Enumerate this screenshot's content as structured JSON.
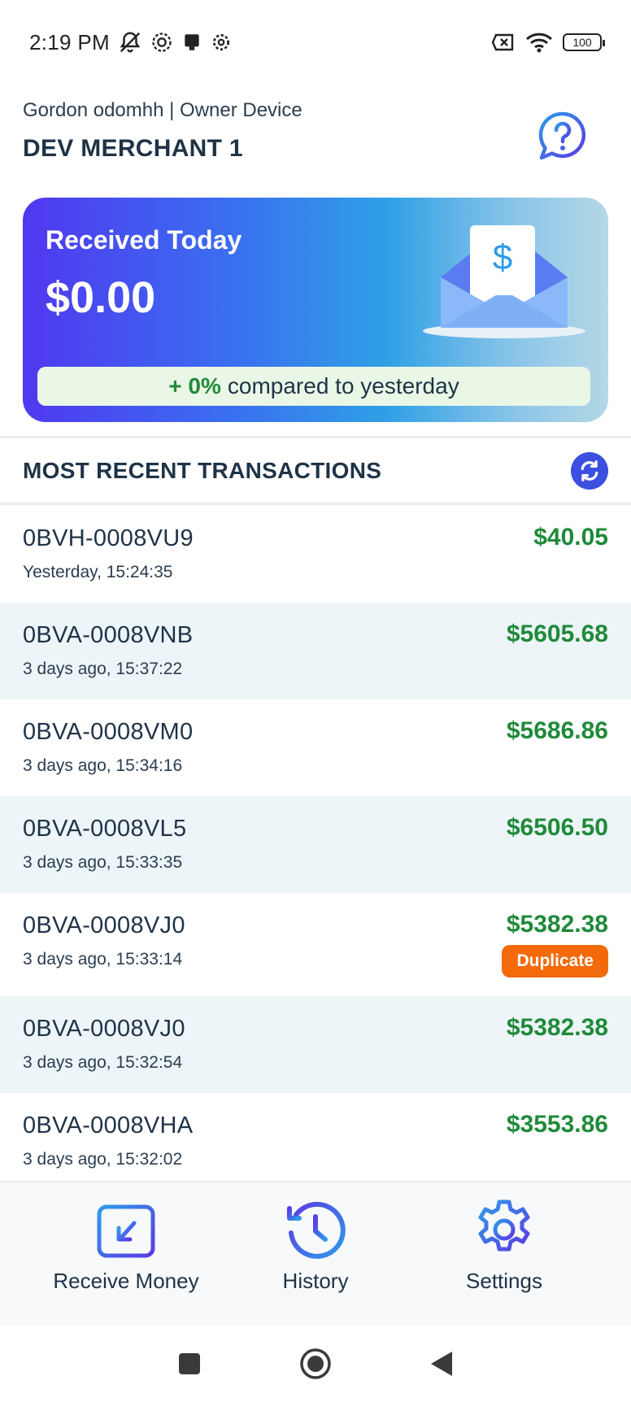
{
  "status_bar": {
    "time": "2:19 PM",
    "battery": "100",
    "icons_left": [
      "bell-muted-icon",
      "settings-cog-icon",
      "notification-icon",
      "gear-icon"
    ],
    "icons_right": [
      "sim-off-icon",
      "wifi-icon",
      "battery-icon"
    ]
  },
  "header": {
    "user_line": "Gordon odomhh | Owner Device",
    "merchant_name": "DEV MERCHANT 1",
    "help_icon": "help-chat-icon"
  },
  "summary": {
    "title": "Received Today",
    "amount": "$0.00",
    "compare_pct": "+ 0%",
    "compare_text": "compared to yesterday"
  },
  "transactions": {
    "title": "MOST RECENT TRANSACTIONS",
    "refresh_icon": "refresh-icon",
    "items": [
      {
        "id": "0BVH-0008VU9",
        "time": "Yesterday, 15:24:35",
        "amount": "$40.05"
      },
      {
        "id": "0BVA-0008VNB",
        "time": "3 days ago, 15:37:22",
        "amount": "$5605.68"
      },
      {
        "id": "0BVA-0008VM0",
        "time": "3 days ago, 15:34:16",
        "amount": "$5686.86"
      },
      {
        "id": "0BVA-0008VL5",
        "time": "3 days ago, 15:33:35",
        "amount": "$6506.50"
      },
      {
        "id": "0BVA-0008VJ0",
        "time": "3 days ago, 15:33:14",
        "amount": "$5382.38",
        "badge": "Duplicate"
      },
      {
        "id": "0BVA-0008VJ0",
        "time": "3 days ago, 15:32:54",
        "amount": "$5382.38"
      },
      {
        "id": "0BVA-0008VHA",
        "time": "3 days ago, 15:32:02",
        "amount": "$3553.86"
      }
    ]
  },
  "bottom_nav": {
    "items": [
      {
        "label": "Receive Money",
        "icon": "receive-money-icon"
      },
      {
        "label": "History",
        "icon": "history-icon"
      },
      {
        "label": "Settings",
        "icon": "settings-icon"
      }
    ]
  },
  "system_nav": [
    "recents-button",
    "home-button",
    "back-button"
  ],
  "colors": {
    "accent": "#3b4fe0",
    "amount_green": "#1f8a3a",
    "badge_orange": "#f26a0a",
    "alt_row": "#edf5f8"
  }
}
